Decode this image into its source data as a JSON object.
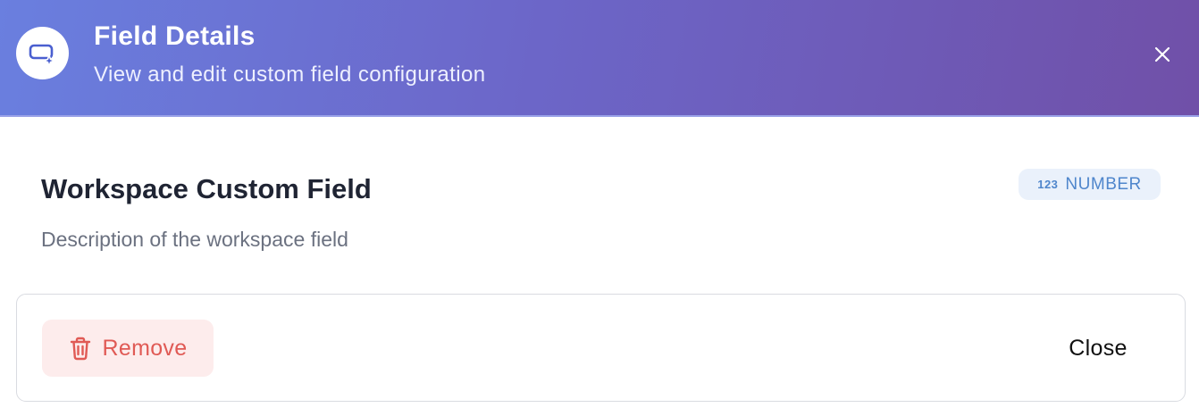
{
  "header": {
    "icon": "custom-field-sparkle-icon",
    "title": "Field Details",
    "subtitle": "View and edit custom field configuration",
    "close_icon": "close-icon",
    "gradient_start": "#6a7fdf",
    "gradient_end": "#7050a8"
  },
  "field": {
    "name": "Workspace Custom Field",
    "description": "Description of the workspace field",
    "type_badge": {
      "icon_text": "123",
      "label": "NUMBER",
      "color": "#4f86cc",
      "background": "#eaf1fb"
    }
  },
  "footer": {
    "remove_label": "Remove",
    "remove_icon": "trash-icon",
    "remove_color": "#e05a55",
    "close_label": "Close"
  }
}
